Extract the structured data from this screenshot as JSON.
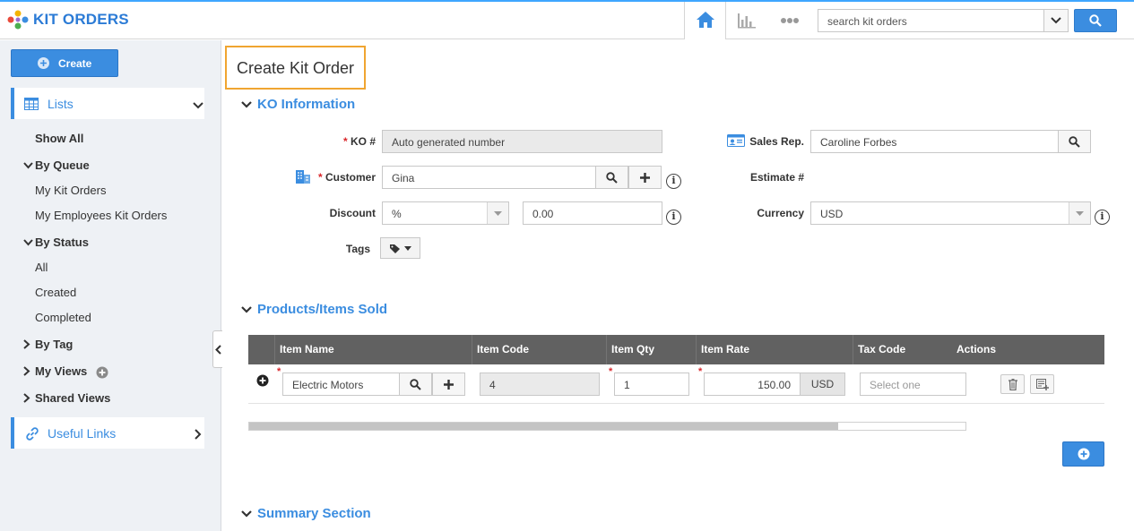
{
  "app": {
    "title": "KIT ORDERS"
  },
  "header": {
    "search_placeholder": "search kit orders",
    "nav": [
      "home-icon",
      "reports-icon",
      "more-icon"
    ]
  },
  "sidebar": {
    "create_label": "Create",
    "lists_label": "Lists",
    "items": [
      {
        "label": "Show All"
      },
      {
        "label": "By Queue"
      },
      {
        "label": "My Kit Orders"
      },
      {
        "label": "My Employees Kit Orders"
      },
      {
        "label": "By Status"
      },
      {
        "label": "All"
      },
      {
        "label": "Created"
      },
      {
        "label": "Completed"
      },
      {
        "label": "By Tag"
      },
      {
        "label": "My Views"
      },
      {
        "label": "Shared Views"
      }
    ],
    "useful_links_label": "Useful Links"
  },
  "main": {
    "page_title": "Create Kit Order",
    "sections": {
      "ko_info": "KO Information",
      "products": "Products/Items Sold",
      "summary": "Summary Section"
    },
    "form": {
      "ko_label": "KO #",
      "ko_value": "Auto generated number",
      "customer_label": "Customer",
      "customer_value": "Gina",
      "discount_label": "Discount",
      "discount_type": "%",
      "discount_value": "0.00",
      "tags_label": "Tags",
      "sales_rep_label": "Sales Rep.",
      "sales_rep_value": "Caroline Forbes",
      "estimate_label": "Estimate #",
      "currency_label": "Currency",
      "currency_value": "USD",
      "required_mark": "*",
      "info_mark": "i"
    },
    "table": {
      "columns": [
        "Item Name",
        "Item Code",
        "Item Qty",
        "Item Rate",
        "Tax Code",
        "Actions"
      ],
      "rows": [
        {
          "item_name": "Electric Motors",
          "item_code": "4",
          "item_qty": "1",
          "item_rate": "150.00",
          "currency": "USD",
          "tax_code_placeholder": "Select one"
        }
      ]
    }
  },
  "colors": {
    "accent": "#3b8de0",
    "title_highlight": "#f0a531",
    "table_header": "#616161",
    "required": "#d9262a"
  }
}
